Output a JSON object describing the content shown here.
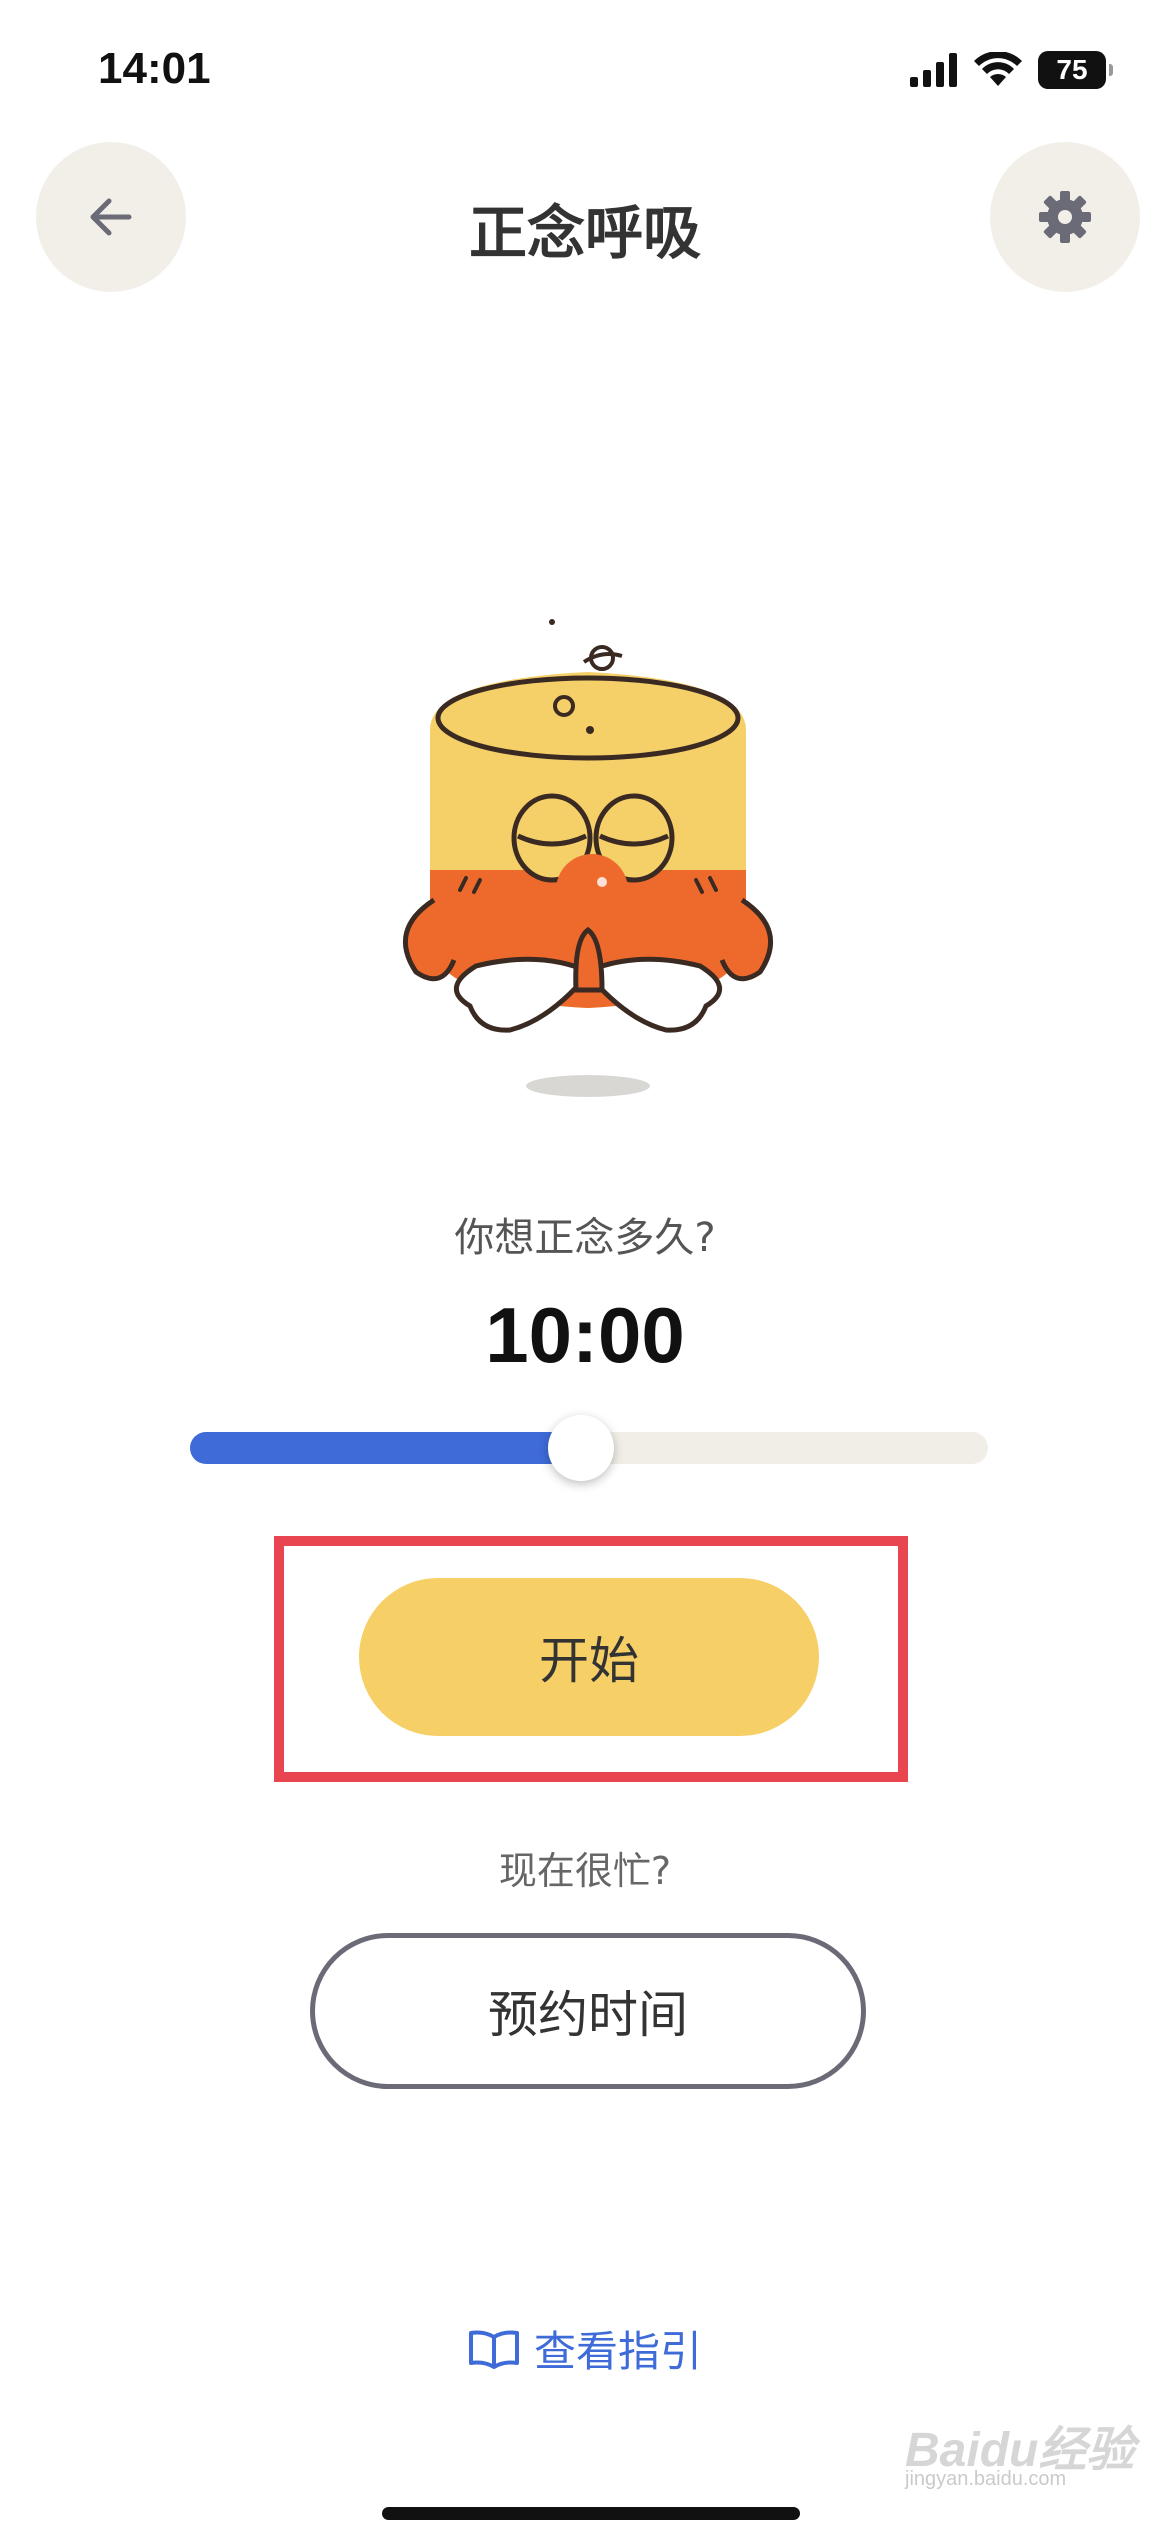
{
  "status_bar": {
    "time": "14:01",
    "battery": "75",
    "icons": [
      "signal-icon",
      "wifi-icon",
      "battery-icon"
    ]
  },
  "header": {
    "title": "正念呼吸",
    "back_icon": "arrow-left-icon",
    "settings_icon": "gear-icon"
  },
  "duration": {
    "question": "你想正念多久?",
    "value": "10:00",
    "slider_fraction": 0.49
  },
  "actions": {
    "start_label": "开始",
    "busy_text": "现在很忙?",
    "schedule_label": "预约时间"
  },
  "footer": {
    "guide_label": "查看指引",
    "guide_icon": "open-book-icon"
  },
  "watermark": {
    "text": "Baidu经验",
    "sub": "jingyan.baidu.com"
  },
  "colors": {
    "accent_yellow": "#f6cf66",
    "slider_blue": "#3e6bd8",
    "highlight_red": "#e84550",
    "button_bg": "#f2efe9"
  }
}
